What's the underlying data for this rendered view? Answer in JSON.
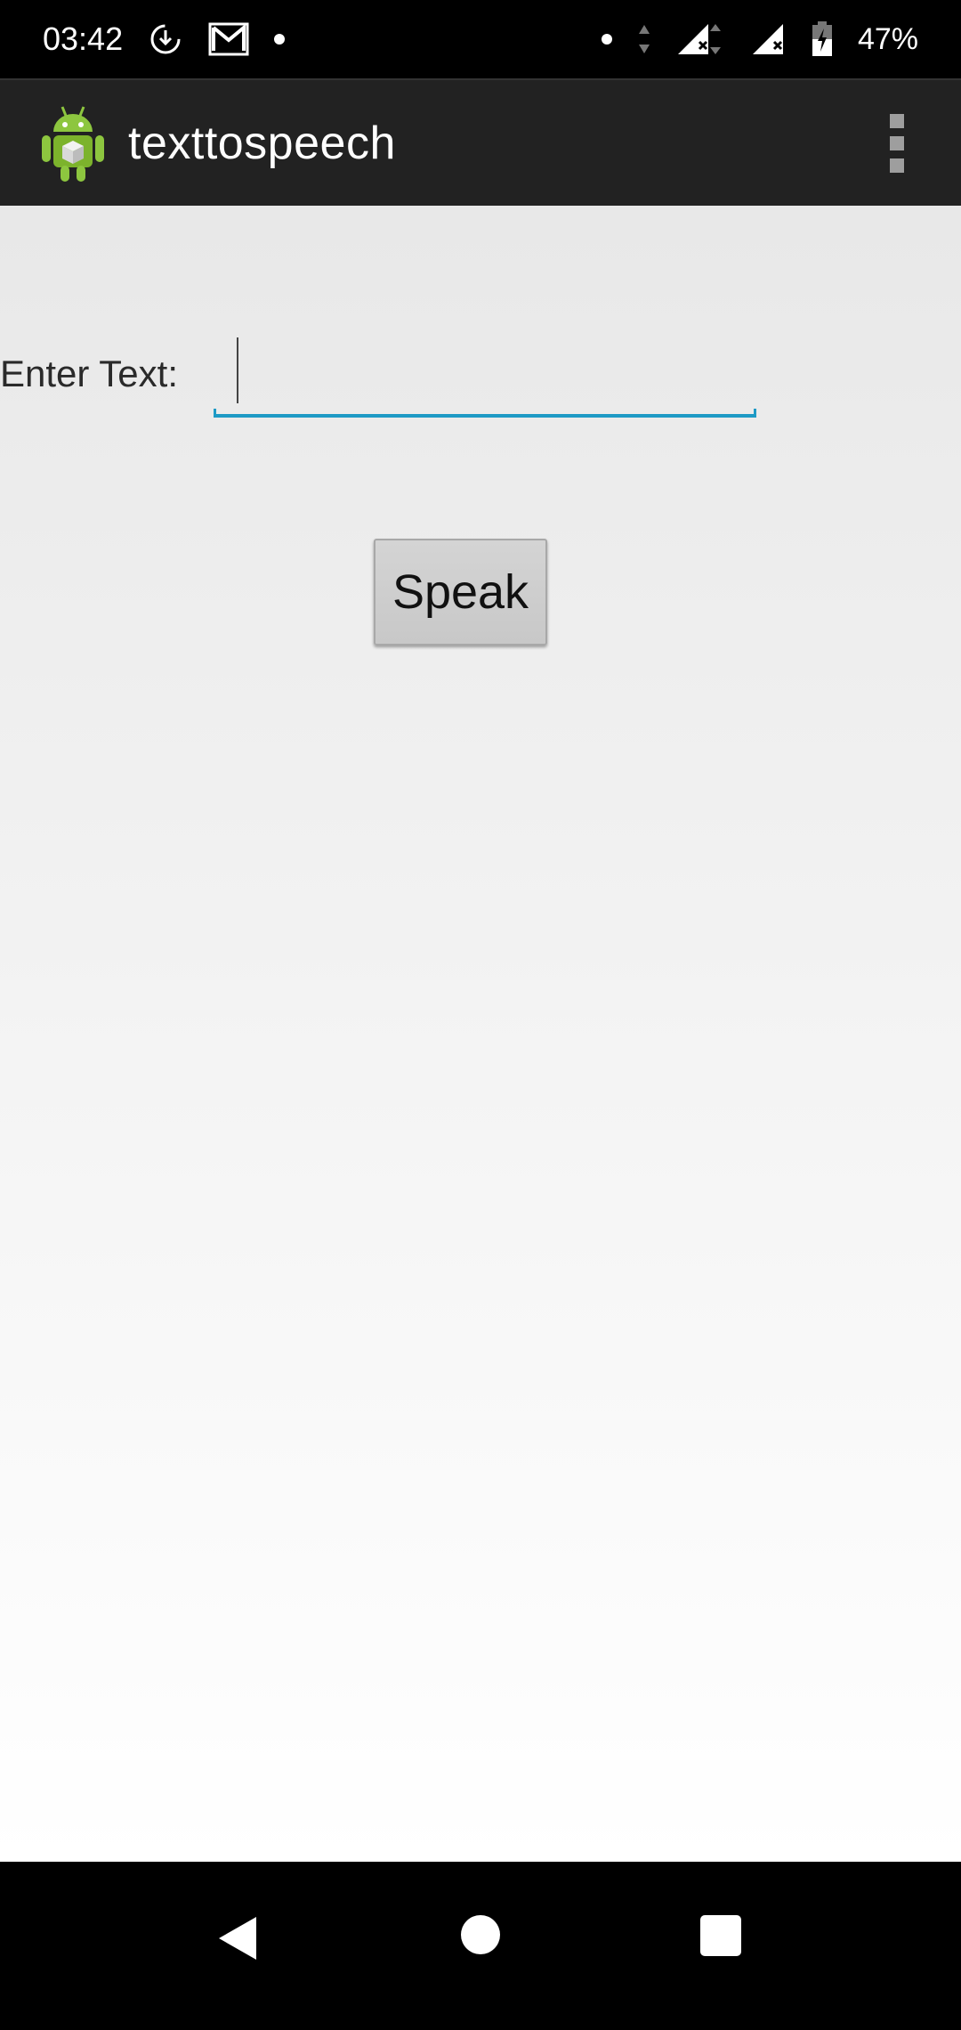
{
  "status_bar": {
    "time": "03:42",
    "left_icons": [
      "sync-download-icon",
      "gmail-icon",
      "notification-dot"
    ],
    "right_icons": [
      "notification-dot",
      "data-arrows-icon",
      "signal-x-icon",
      "signal-x-icon",
      "battery-charging-icon"
    ],
    "battery_percent": "47%"
  },
  "app_bar": {
    "title": "texttospeech",
    "logo_icon": "android-robot-icon",
    "menu_icon": "overflow-menu-icon"
  },
  "form": {
    "label": "Enter Text:",
    "input_value": "",
    "input_placeholder": "",
    "button_label": "Speak"
  },
  "nav_bar": {
    "icons": [
      "back-icon",
      "home-icon",
      "recents-icon"
    ]
  },
  "colors": {
    "accent": "#1e9ac5",
    "app_bar": "#222222",
    "status_bar": "#000000",
    "button": "#d0d0d0"
  }
}
